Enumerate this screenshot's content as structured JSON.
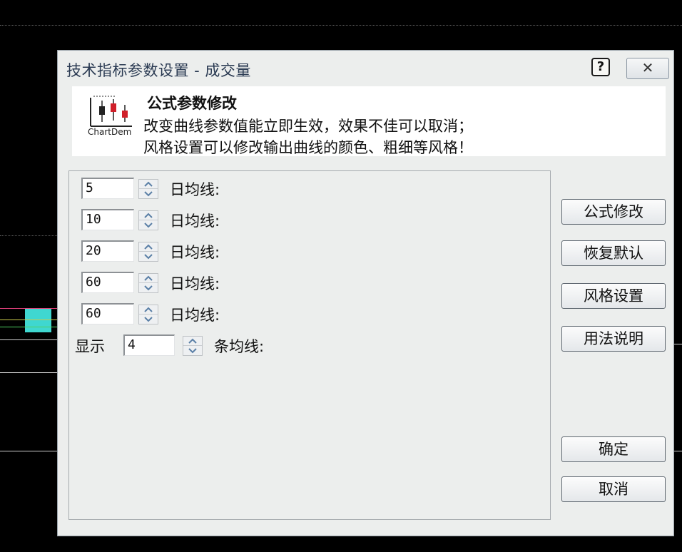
{
  "dialog": {
    "title": "技术指标参数设置 - 成交量",
    "help_label": "?",
    "close_label": "✕"
  },
  "header": {
    "logo_caption": "ChartDem",
    "title": "公式参数修改",
    "desc_line1": "改变曲线参数值能立即生效，效果不佳可以取消；",
    "desc_line2": "风格设置可以修改输出曲线的颜色、粗细等风格！"
  },
  "params": {
    "rows": [
      {
        "value": "5",
        "label": "日均线:"
      },
      {
        "value": "10",
        "label": "日均线:"
      },
      {
        "value": "20",
        "label": "日均线:"
      },
      {
        "value": "60",
        "label": "日均线:"
      },
      {
        "value": "60",
        "label": "日均线:"
      }
    ],
    "show_prefix": "显示",
    "show_count": "4",
    "show_suffix": "条均线:"
  },
  "buttons": {
    "formula_edit": "公式修改",
    "restore_default": "恢复默认",
    "style_settings": "风格设置",
    "usage_help": "用法说明",
    "ok": "确定",
    "cancel": "取消"
  },
  "colors": {
    "dialog_bg": "#eceeed",
    "title_text": "#2a3a52",
    "candle_red": "#d0202a",
    "chart_cyan": "#3fd7d0"
  }
}
